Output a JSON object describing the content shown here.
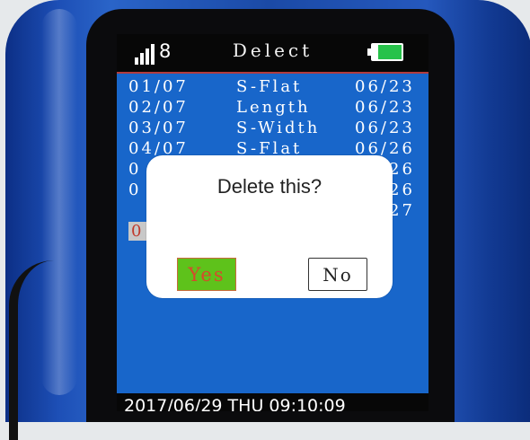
{
  "header": {
    "signal_count": "8",
    "title": "Delect"
  },
  "records": [
    {
      "index": "01/07",
      "type": "S-Flat",
      "date": "06/23"
    },
    {
      "index": "02/07",
      "type": "Length",
      "date": "06/23"
    },
    {
      "index": "03/07",
      "type": "S-Width",
      "date": "06/23"
    },
    {
      "index": "04/07",
      "type": "S-Flat",
      "date": "06/26"
    },
    {
      "index": "0",
      "type": "",
      "date": "26"
    },
    {
      "index": "0",
      "type": "",
      "date": "26"
    },
    {
      "index": "",
      "type": "",
      "date": "27"
    }
  ],
  "selected_marker": "0",
  "footer": {
    "datetime": "2017/06/29  THU  09:10:09"
  },
  "dialog": {
    "title": "Delete this?",
    "yes_label": "Yes",
    "no_label": "No"
  },
  "colors": {
    "screen_blue": "#1866ca",
    "yes_green": "#5ec21b",
    "battery_green": "#27c24a"
  },
  "icons": [
    "signal-icon",
    "battery-icon"
  ]
}
